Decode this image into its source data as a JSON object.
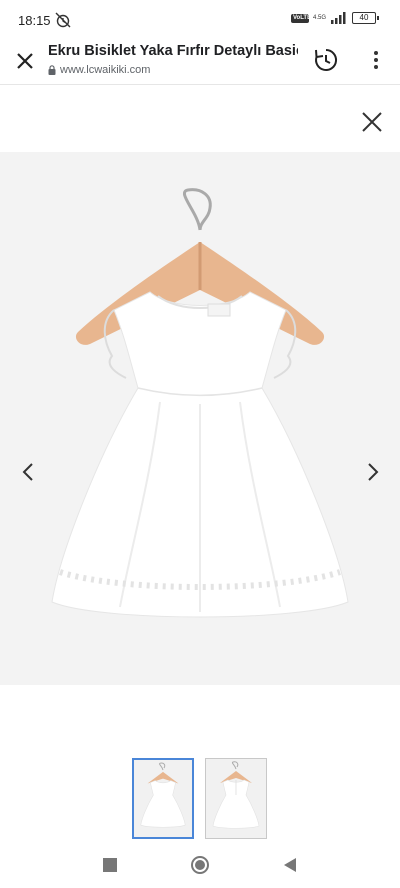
{
  "status_bar": {
    "time": "18:15",
    "network_badge": "VoLTE",
    "network_type": "4.5G",
    "battery": "40"
  },
  "browser": {
    "page_title": "Ekru Bisiklet Yaka Fırfır Detaylı Basic",
    "url": "www.lcwaikiki.com"
  },
  "icons": {
    "close": "close-icon",
    "history": "history-icon",
    "menu": "more-vert-icon",
    "prev": "chevron-left-icon",
    "next": "chevron-right-icon",
    "nav_recents": "square-icon",
    "nav_home": "circle-icon",
    "nav_back": "triangle-back-icon"
  },
  "gallery": {
    "thumbnail_count": 2,
    "active_thumbnail": 1
  },
  "colors": {
    "active_border": "#4a86d8",
    "image_background": "#f3f3f3"
  }
}
